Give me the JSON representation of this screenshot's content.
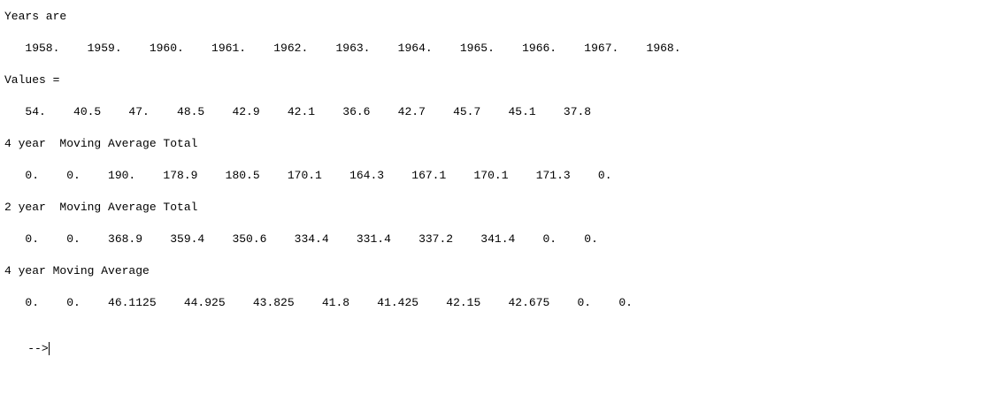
{
  "console": {
    "years_label": "Years are",
    "years_values": "   1958.    1959.    1960.    1961.    1962.    1963.    1964.    1965.    1966.    1967.    1968.",
    "values_label": "Values =",
    "values_row": "   54.    40.5    47.    48.5    42.9    42.1    36.6    42.7    45.7    45.1    37.8",
    "ma4_total_label": "4 year  Moving Average Total",
    "ma4_total_row": "   0.    0.    190.    178.9    180.5    170.1    164.3    167.1    170.1    171.3    0.",
    "ma2_total_label": "2 year  Moving Average Total",
    "ma2_total_row": "   0.    0.    368.9    359.4    350.6    334.4    331.4    337.2    341.4    0.    0.",
    "ma4_label": "4 year Moving Average",
    "ma4_row": "   0.    0.    46.1125    44.925    43.825    41.8    41.425    42.15    42.675    0.    0.",
    "prompt": "-->"
  }
}
